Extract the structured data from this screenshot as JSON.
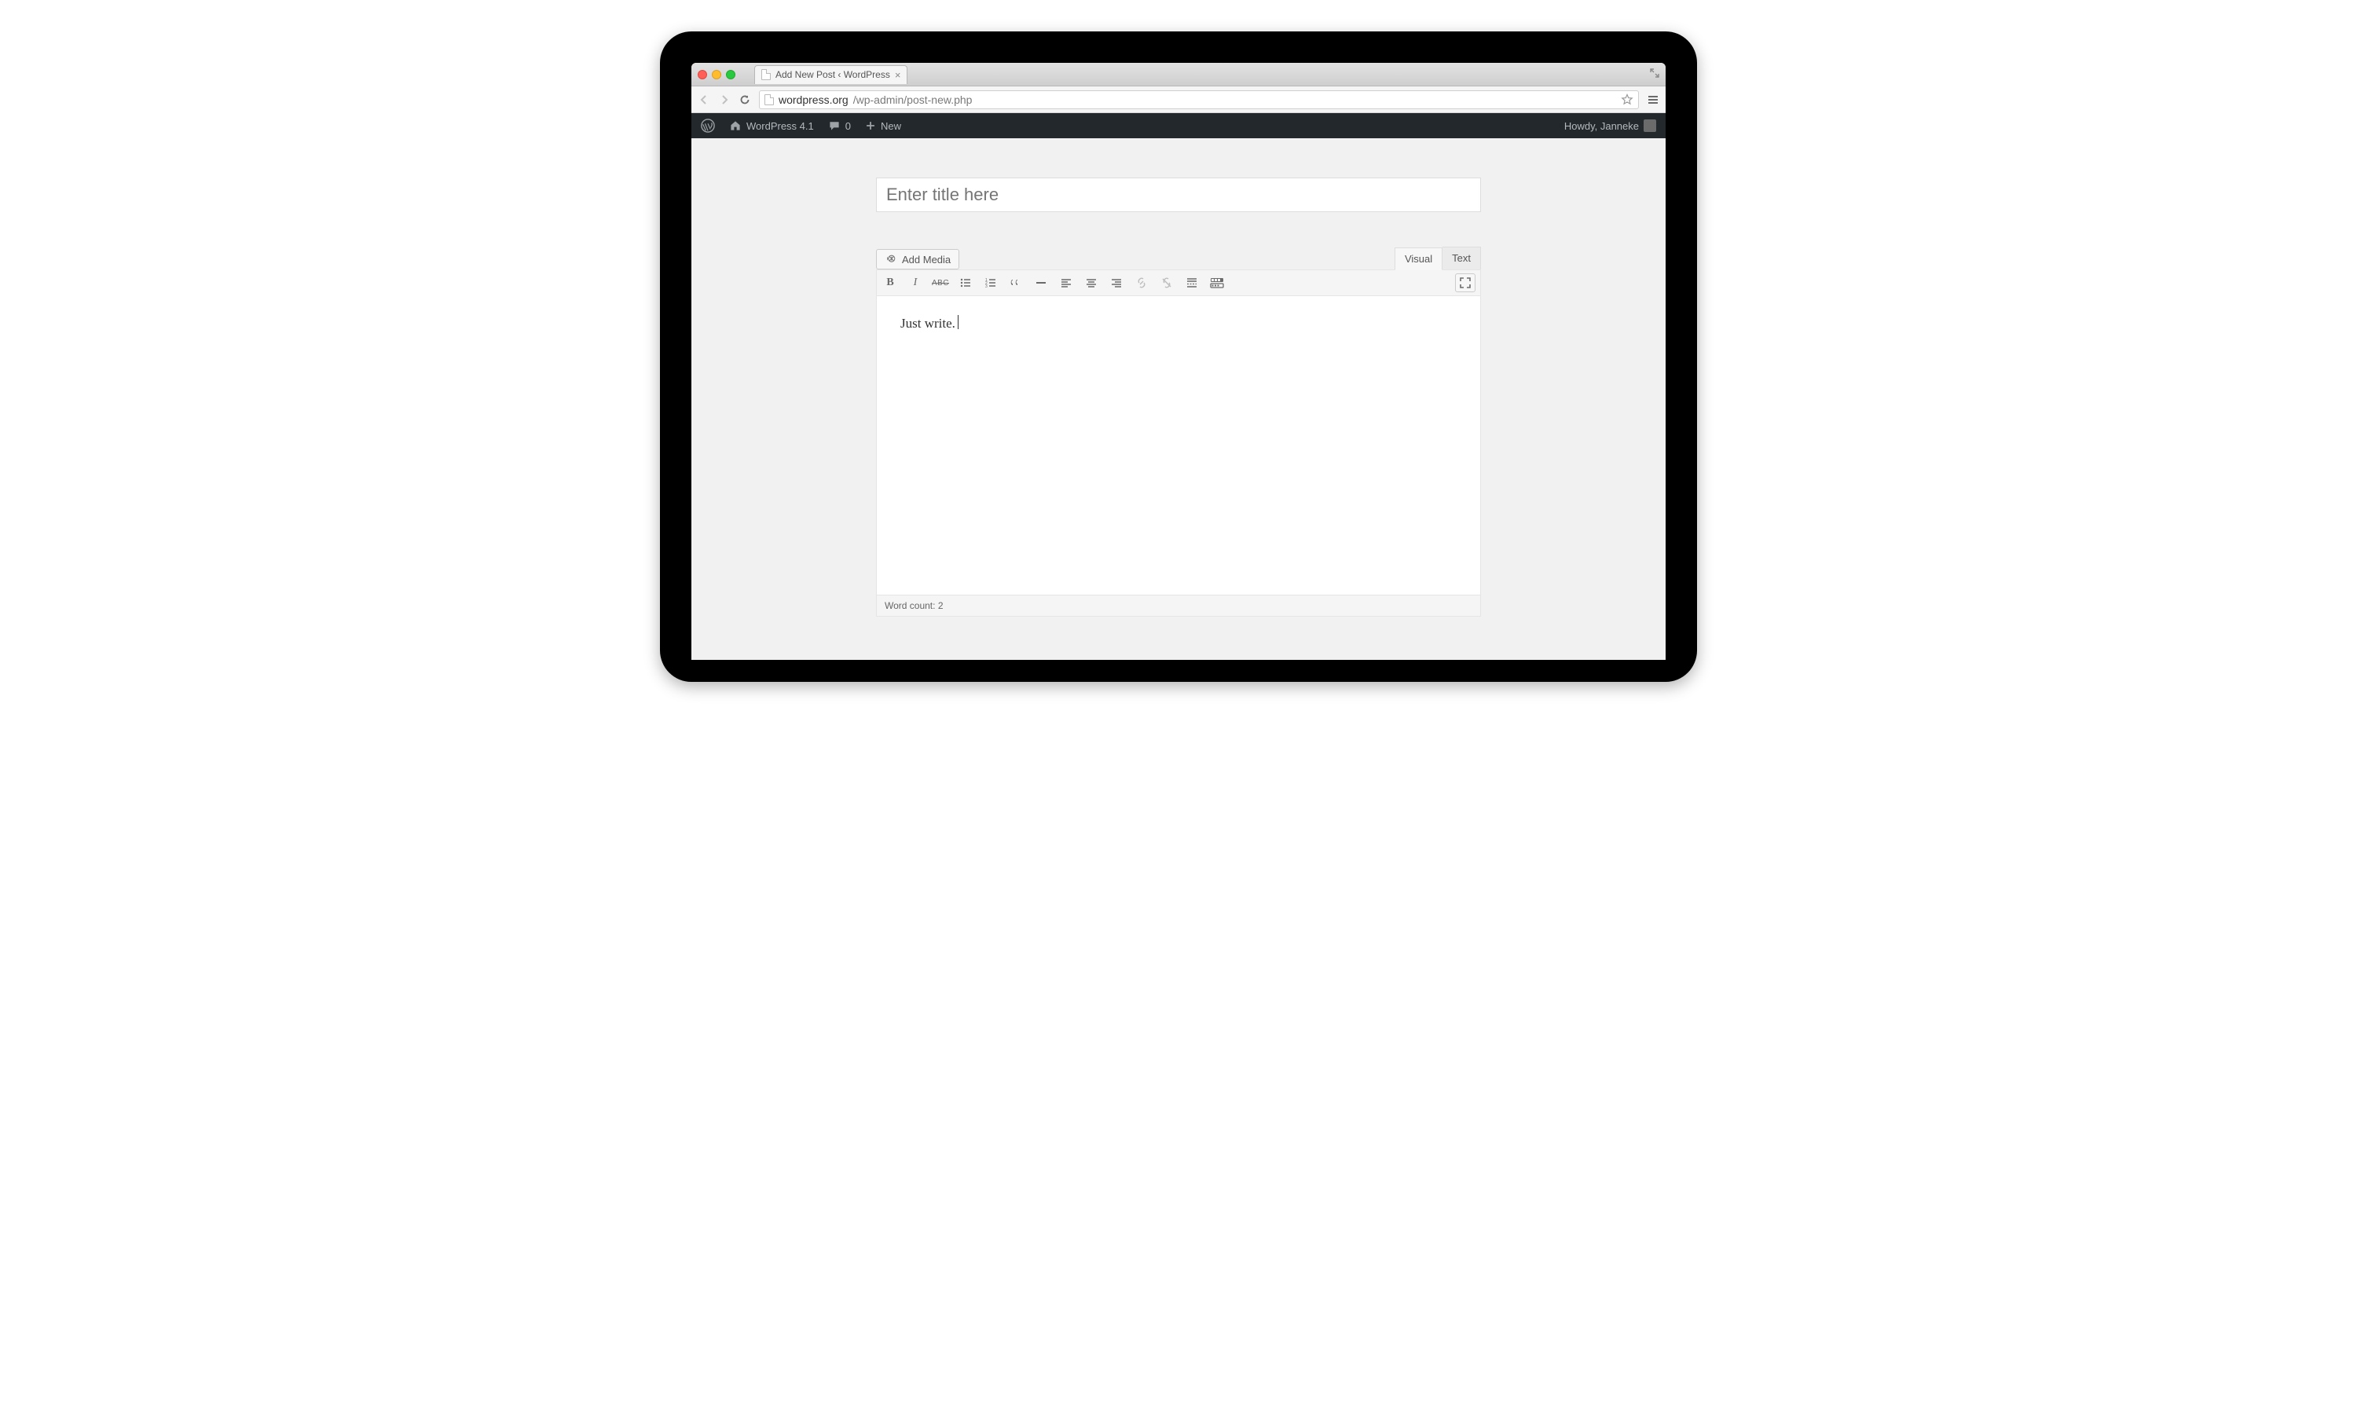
{
  "browser": {
    "tab_title": "Add New Post ‹ WordPress",
    "url_host": "wordpress.org",
    "url_path": "/wp-admin/post-new.php"
  },
  "adminbar": {
    "site_name": "WordPress 4.1",
    "comments_count": "0",
    "new_label": "New",
    "howdy": "Howdy, Janneke"
  },
  "editor": {
    "title_placeholder": "Enter title here",
    "add_media_label": "Add Media",
    "tabs": {
      "visual": "Visual",
      "text": "Text"
    },
    "content": "Just write.",
    "word_count_label": "Word count:",
    "word_count_value": "2",
    "toolbar": {
      "bold": "B",
      "italic": "I",
      "strike": "ABC"
    }
  }
}
